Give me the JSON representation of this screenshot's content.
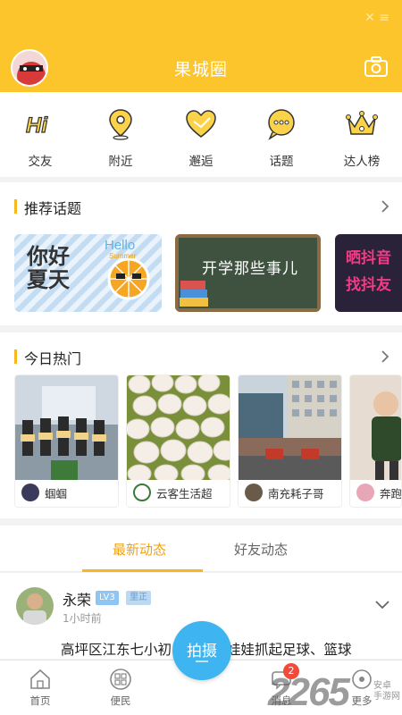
{
  "header": {
    "title": "果城圈"
  },
  "quick_nav": [
    {
      "label": "交友",
      "icon": "hi-icon"
    },
    {
      "label": "附近",
      "icon": "location-pin-icon"
    },
    {
      "label": "邂逅",
      "icon": "heart-icon"
    },
    {
      "label": "话题",
      "icon": "chat-bubble-icon"
    },
    {
      "label": "达人榜",
      "icon": "crown-icon"
    }
  ],
  "recommended": {
    "title": "推荐话题",
    "topics": [
      {
        "text_main": "你好夏天",
        "text_en": "Hello",
        "text_sub": "Summer"
      },
      {
        "text_main": "开学那些事儿"
      },
      {
        "text_main": "晒抖音 找抖友"
      }
    ]
  },
  "hot": {
    "title": "今日热门",
    "items": [
      {
        "user": "蝈蝈"
      },
      {
        "user": "云客生活超"
      },
      {
        "user": "南充耗子哥"
      },
      {
        "user": "奔跑"
      }
    ]
  },
  "tabs": {
    "latest": "最新动态",
    "friends": "好友动态"
  },
  "post": {
    "name": "永荣",
    "level": "LV3",
    "tag": "里正",
    "time": "1小时前",
    "text": "高坪区江东七小初中校区从娃娃抓起足球、篮球"
  },
  "bottom_nav": {
    "home": "首页",
    "service": "便民",
    "post_button": "拍摄",
    "messages": "消息",
    "more": "更多",
    "notify_count": "2"
  },
  "watermark": {
    "text": "2265",
    "sub1": "安卓",
    "sub2": "手游网"
  },
  "colors": {
    "brand": "#fbc52b",
    "accent": "#f0a30e",
    "post_button": "#3eb4f0",
    "badge": "#f04b3a"
  }
}
